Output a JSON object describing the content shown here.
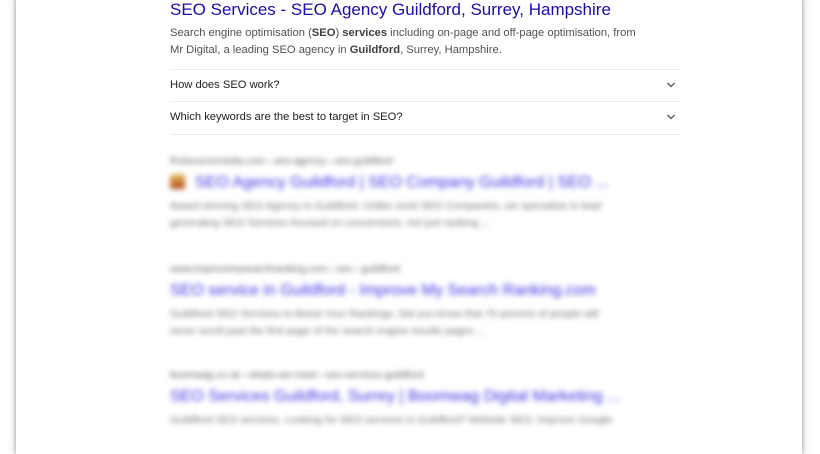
{
  "result": {
    "title": "SEO Services - SEO Agency Guildford, Surrey, Hampshire",
    "snippet_line1": {
      "a": "Search engine optimisation (",
      "b": "SEO",
      "c": ") ",
      "d": "services",
      "e": " including on-page and off-page optimisation, from"
    },
    "snippet_line2": {
      "a": "Mr Digital, a leading SEO agency in ",
      "b": "Guildford",
      "c": ", Surrey, Hampshire."
    }
  },
  "faq": [
    {
      "question": "How does SEO work?",
      "icon": "chevron-down-icon"
    },
    {
      "question": "Which keywords are the best to target in SEO?",
      "icon": "chevron-down-icon"
    }
  ],
  "blurred_results": [
    {
      "url": "firstsourcemedia.com › seo-agency › seo-guildford",
      "title": "SEO Agency Guildford | SEO Company Guildford | SEO ...",
      "snippet1": "Award winning SEO Agency in Guildford. Unlike most SEO Companies, we specialise in lead",
      "snippet2": "generating SEO Services focused on conversions, not just ranking ..."
    },
    {
      "url": "www.improvemysearchranking.com › seo › guildford",
      "title": "SEO service in Guildford - Improve My Search Ranking.com",
      "snippet1": "Guildford SEO Services to Boost Your Rankings. Did you know that 75 percent of people will",
      "snippet2": "never scroll past the first page of the search engine results pages ..."
    },
    {
      "url": "boomwag.co.uk › whats-we-meet › seo-services-guildford",
      "title": "SEO Services Guildford, Surrey | Boomwag Digital Marketing ...",
      "snippet1": "Guildford SEO services. Looking for SEO services in Guildford? Website SEO, Improve Google"
    }
  ]
}
